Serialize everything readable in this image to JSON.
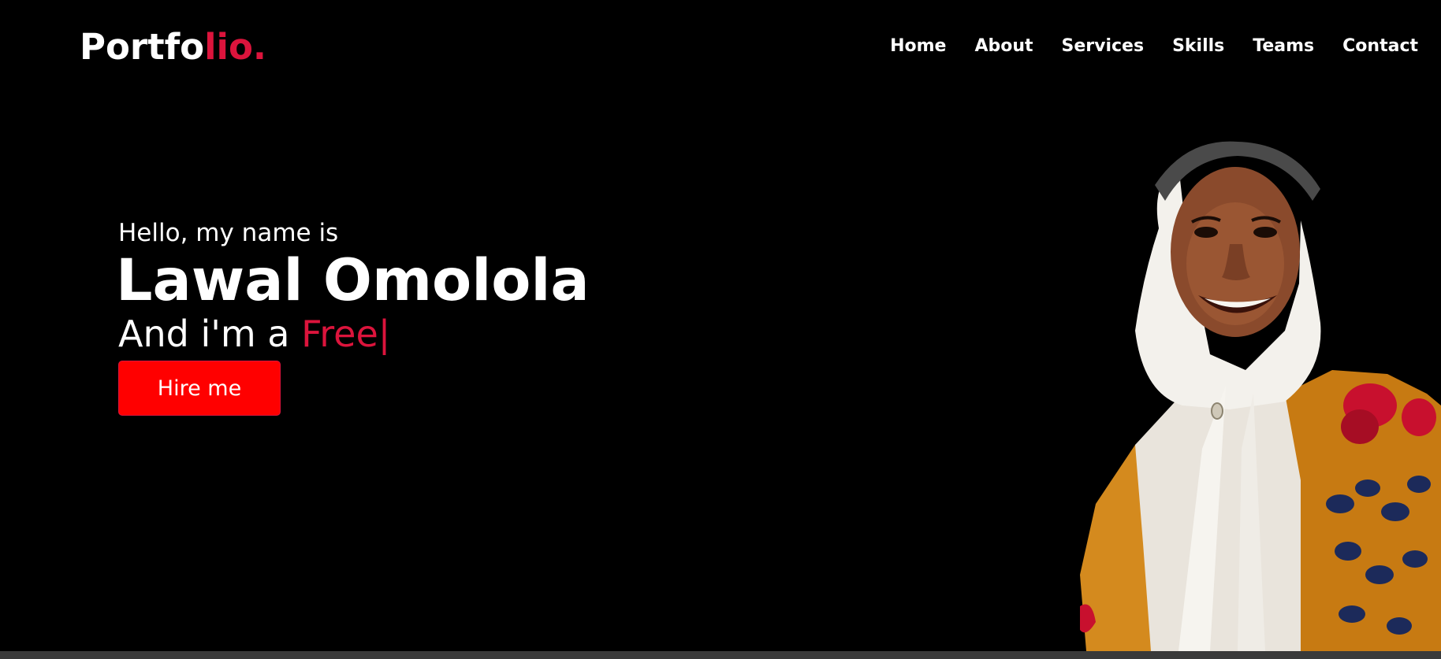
{
  "navbar": {
    "logo": {
      "main": "Portfo",
      "accent": "lio."
    },
    "menu": [
      "Home",
      "About",
      "Services",
      "Skills",
      "Teams",
      "Contact"
    ]
  },
  "hero": {
    "greeting": "Hello, my name is",
    "name": "Lawal Omolola",
    "tagline_prefix": "And i'm a ",
    "typed_text": "Free",
    "cursor": "|",
    "hire_button": "Hire me"
  },
  "colors": {
    "background": "#000000",
    "accent": "#dc143c",
    "button": "#ff0000"
  }
}
